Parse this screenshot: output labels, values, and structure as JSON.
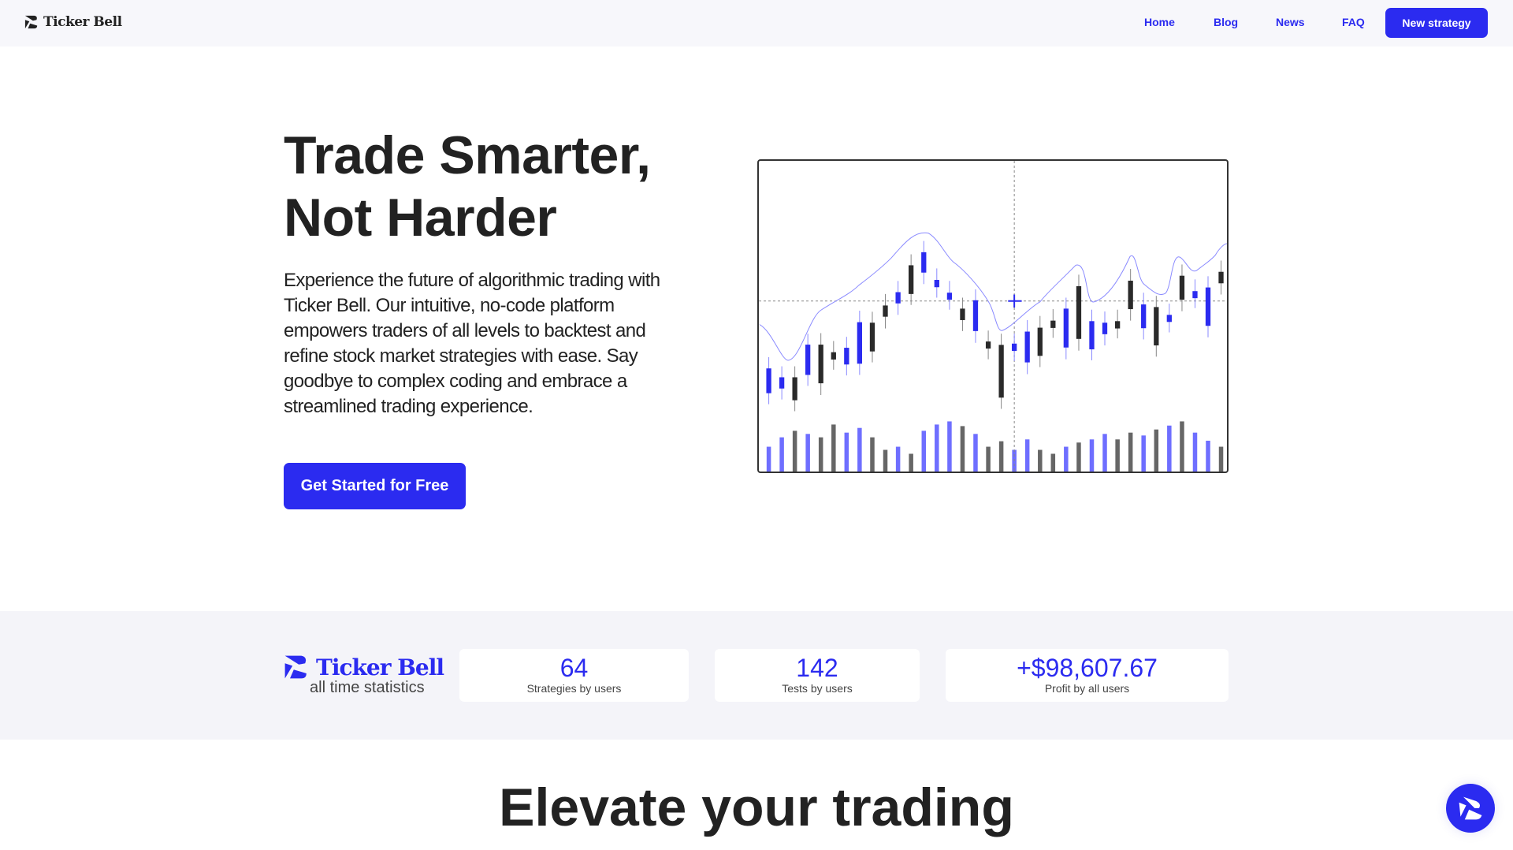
{
  "header": {
    "brand": "Ticker Bell",
    "nav": [
      {
        "label": "Home"
      },
      {
        "label": "Blog"
      },
      {
        "label": "News"
      },
      {
        "label": "FAQ"
      }
    ],
    "cta_label": "New strategy"
  },
  "hero": {
    "title_line1": "Trade Smarter,",
    "title_line2": "Not Harder",
    "description": "Experience the future of algorithmic trading with Ticker Bell. Our intuitive, no-code platform empowers traders of all levels to backtest and refine stock market strategies with ease. Say goodbye to complex coding and embrace a streamlined trading experience.",
    "cta_label": "Get Started for Free",
    "chart_colors": {
      "up": "#2b2bf0",
      "down": "#2a2a2a",
      "volume_up": "#6e6eff",
      "volume_down": "#666666",
      "line": "#8a8aff"
    }
  },
  "stats": {
    "brand": "Ticker Bell",
    "subtitle": "all time statistics",
    "items": [
      {
        "value": "64",
        "label": "Strategies by users"
      },
      {
        "value": "142",
        "label": "Tests by users"
      },
      {
        "value": "+$98,607.67",
        "label": "Profit by all users"
      }
    ]
  },
  "section": {
    "title": "Elevate your trading"
  },
  "colors": {
    "accent": "#2b2bf0",
    "text": "#222222",
    "header_bg": "#f7f7fb",
    "stats_bg": "#f4f4f9"
  }
}
